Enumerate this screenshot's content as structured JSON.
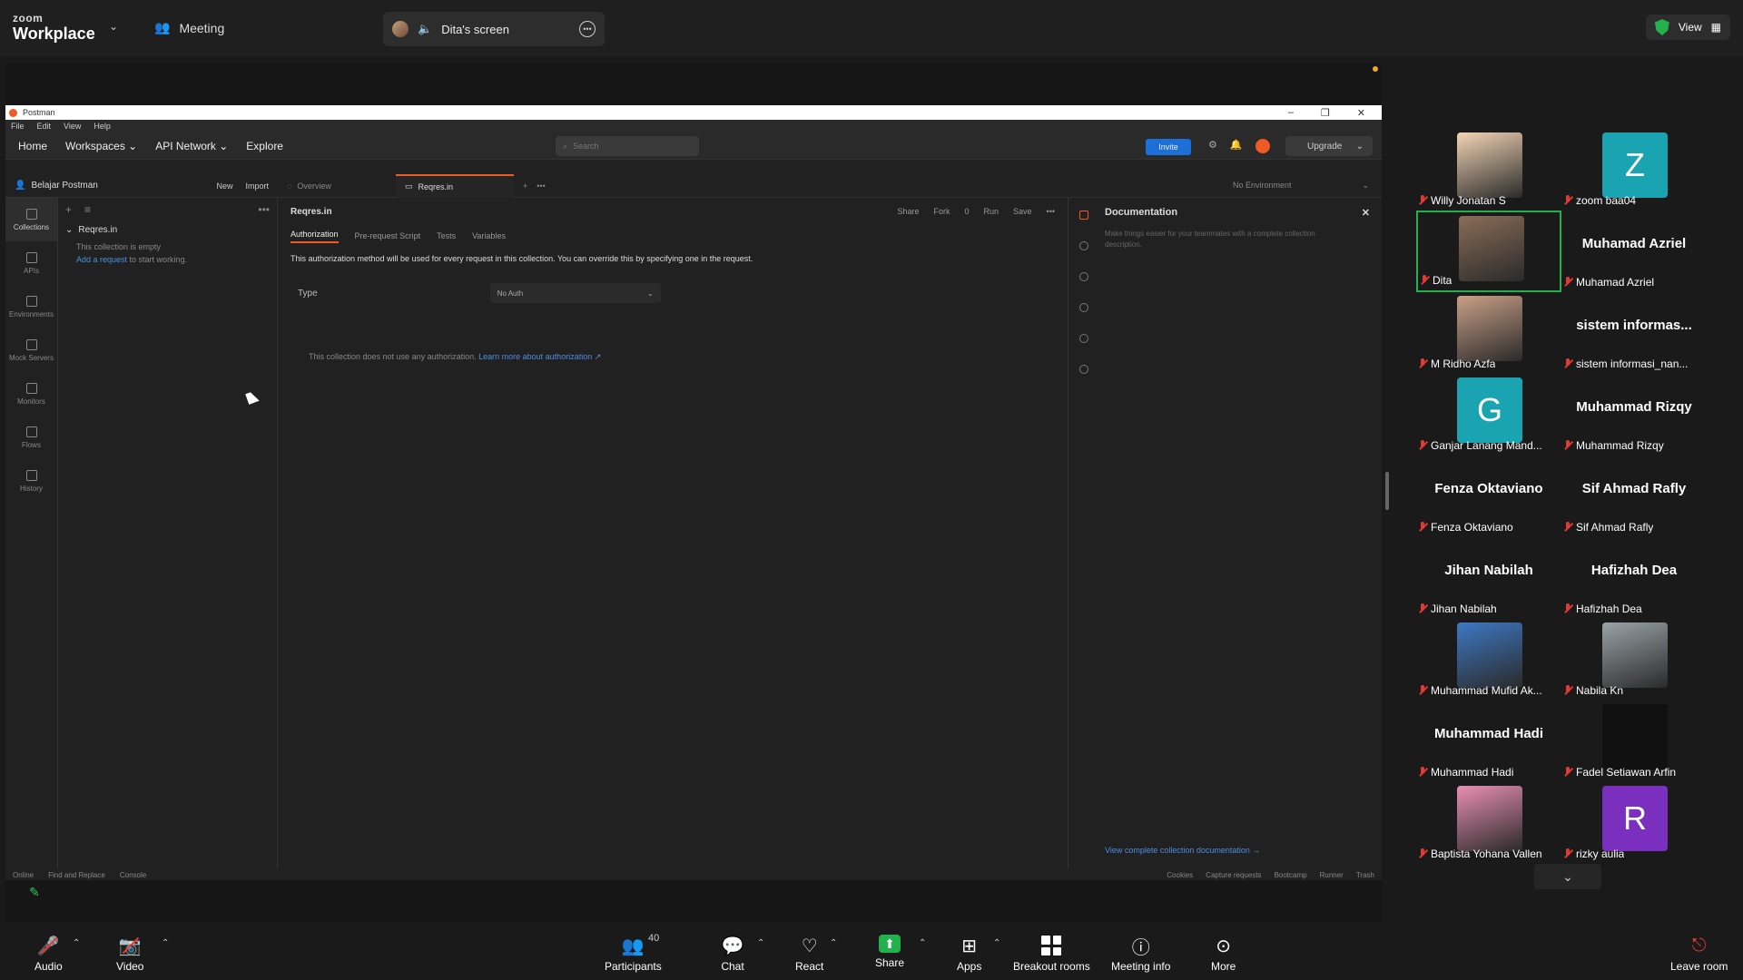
{
  "zoom": {
    "logo_small": "zoom",
    "logo_big": "Workplace",
    "meeting_tab": "Meeting",
    "screen_tab": "Dita's screen",
    "view_label": "View"
  },
  "postman": {
    "window_title": "Postman",
    "menu": [
      "File",
      "Edit",
      "View",
      "Help"
    ],
    "nav": [
      "Home",
      "Workspaces",
      "API Network",
      "Explore"
    ],
    "search_placeholder": "Search",
    "invite": "Invite",
    "upgrade": "Upgrade",
    "workspace_name": "Belajar Postman",
    "new_btn": "New",
    "import_btn": "Import",
    "tabs": [
      "Overview",
      "Reqres.in"
    ],
    "environment": "No Environment",
    "rail": [
      "Collections",
      "APIs",
      "Environments",
      "Mock Servers",
      "Monitors",
      "Flows",
      "History"
    ],
    "collection_name": "Reqres.in",
    "collection_empty": "This collection is empty",
    "add_request_link": "Add a request",
    "add_request_suffix": " to start working.",
    "main_title": "Reqres.in",
    "actions": [
      "Share",
      "Fork",
      "0",
      "Run",
      "Save"
    ],
    "subtabs": [
      "Authorization",
      "Pre-request Script",
      "Tests",
      "Variables"
    ],
    "auth_desc": "This authorization method will be used for every request in this collection. You can override this by specifying one in the request.",
    "type_label": "Type",
    "type_value": "No Auth",
    "auth_note": "This collection does not use any authorization. ",
    "auth_note_link": "Learn more about authorization ↗",
    "doc_title": "Documentation",
    "doc_text": "Make things easier for your teammates with a complete collection description.",
    "doc_link": "View complete collection documentation →",
    "status_left": [
      "Online",
      "Find and Replace",
      "Console"
    ],
    "status_right": [
      "Cookies",
      "Capture requests",
      "Bootcamp",
      "Runner",
      "Trash"
    ]
  },
  "participants": [
    {
      "label": "Willy Jonatan S",
      "kind": "photo",
      "color": "#f3d5b5"
    },
    {
      "label": "zoom baa04",
      "kind": "letter",
      "letter": "Z",
      "color": "#1aa3b0"
    },
    {
      "label": "Dita",
      "kind": "photo",
      "color": "#8a6d58",
      "active": true
    },
    {
      "label": "Muhamad Azriel",
      "kind": "name",
      "bigname": "Muhamad Azriel"
    },
    {
      "label": "M Ridho Azfa",
      "kind": "photo",
      "color": "#caa088"
    },
    {
      "label": "sistem informasi_nan...",
      "kind": "name",
      "bigname": "sistem informas..."
    },
    {
      "label": "Ganjar Lanang Mand...",
      "kind": "letter",
      "letter": "G",
      "color": "#1aa3b0"
    },
    {
      "label": "Muhammad Rizqy",
      "kind": "name",
      "bigname": "Muhammad Rizqy"
    },
    {
      "label": "Fenza Oktaviano",
      "kind": "name",
      "bigname": "Fenza Oktaviano"
    },
    {
      "label": "Sif Ahmad Rafly",
      "kind": "name",
      "bigname": "Sif Ahmad Rafly"
    },
    {
      "label": "Jihan Nabilah",
      "kind": "name",
      "bigname": "Jihan Nabilah"
    },
    {
      "label": "Hafizhah Dea",
      "kind": "name",
      "bigname": "Hafizhah Dea"
    },
    {
      "label": "Muhammad Mufid Ak...",
      "kind": "photo",
      "color": "#3d78c4"
    },
    {
      "label": "Nabila Kn",
      "kind": "photo",
      "color": "#9aa3a8"
    },
    {
      "label": "Muhammad Hadi",
      "kind": "name",
      "bigname": "Muhammad Hadi"
    },
    {
      "label": "Fadel Setiawan Arfin",
      "kind": "dark"
    },
    {
      "label": "Baptista Yohana Vallen",
      "kind": "photo",
      "color": "#e98fb0"
    },
    {
      "label": "rizky aulia",
      "kind": "letter",
      "letter": "R",
      "color": "#7b2fbe"
    }
  ],
  "toolbar": {
    "audio": "Audio",
    "video": "Video",
    "participants": "Participants",
    "participants_count": "40",
    "chat": "Chat",
    "react": "React",
    "share": "Share",
    "apps": "Apps",
    "breakout": "Breakout rooms",
    "info": "Meeting info",
    "more": "More",
    "leave": "Leave room"
  }
}
